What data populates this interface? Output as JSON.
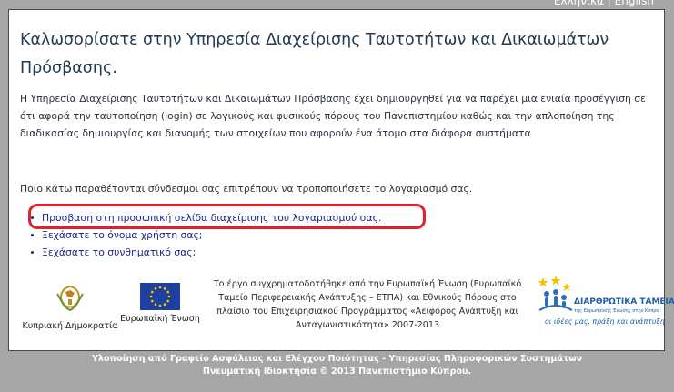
{
  "language_switch": {
    "greek": "Ελληνικά",
    "separator": "|",
    "english": "English"
  },
  "page": {
    "title": "Καλωσορίσατε στην Υπηρεσία Διαχείρισης Ταυτοτήτων και Δικαιωμάτων Πρόσβασης.",
    "intro": "Η Υπηρεσία Διαχείρισης Ταυτοτήτων και Δικαιωμάτων Πρόσβασης έχει δημιουργηθεί για να παρέχει μια ενιαία προσέγγιση σε ότι αφορά την ταυτοποίηση (login) σε λογικούς και φυσικούς πόρους του Πανεπιστημίου καθώς και την απλοποίηση της διαδικασίας δημιουργίας και διανομής των στοιχείων που αφορούν ένα άτομο στα διάφορα συστήματα",
    "links_intro": "Ποιο κάτω παραθέτονται σύνδεσμοι σας επιτρέπουν να τροποποιήσετε το λογαριασμό σας.",
    "links": [
      "Προσβαση στη προσωπική σελίδα διαχείρισης του λογαριασμού σας.",
      "Ξεχάσατε το όνομα χρήστη σας;",
      "Ξεχάσατε το συνθηματικό σας;"
    ]
  },
  "logos": {
    "cyprus_caption": "Κυπριακή Δημοκρατία",
    "eu_caption": "Ευρωπαϊκή Ένωση",
    "ds_title": "ΔΙΑΡΘΡΩΤΙΚΑ ΤΑΜΕΙΑ",
    "ds_subtitle": "της Ευρωπαϊκής Ένωσης στην Κύπρο",
    "ds_slogan": "οι ιδέες μας, πράξη και ανάπτυξη"
  },
  "funding_text": "Το έργο συγχρηματοδοτήθηκε από την Ευρωπαϊκή Ένωση (Ευρωπαϊκό Ταμείο Περιφερειακής Ανάπτυξης – ΕΤΠΑ) και Εθνικούς Πόρους στο πλαίσιο του Επιχειρησιακού Προγράμματος «Αειφόρος Ανάπτυξη και Ανταγωνιστικότητα» 2007-2013",
  "footer": {
    "line1": "Υλοποίηση από Γραφείο Ασφάλειας και Ελέγχου Ποιότητας - Υπηρεσίας Πληροφορικών Συστημάτων",
    "line2": "Πνευματική Ιδιοκτησία © 2013 Πανεπιστήμιο Κύπρου."
  },
  "colors": {
    "background": "#a6a6a6",
    "link": "#1a2a8a",
    "highlight": "#e0202a",
    "eu_blue": "#1e3fa0",
    "eu_star": "#ffcc00"
  }
}
